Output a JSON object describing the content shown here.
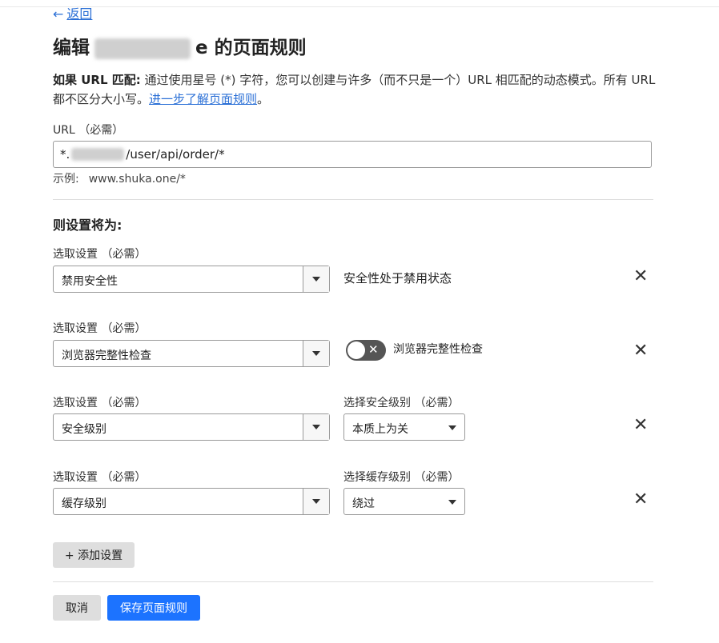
{
  "nav": {
    "back_arrow": "←",
    "back_label": "返回"
  },
  "page": {
    "title_prefix": "编辑",
    "title_partial": "e",
    "title_suffix": "的页面规则"
  },
  "description": {
    "bold": "如果 URL 匹配:",
    "text": " 通过使用星号 (*) 字符，您可以创建与许多（而不只是一个）URL 相匹配的动态模式。所有 URL 都不区分大小写。",
    "link": "进一步了解页面规则",
    "end": "。"
  },
  "url_field": {
    "label": "URL （必需）",
    "value_prefix": "*.",
    "value_suffix": "/user/api/order/*",
    "example_label": "示例:",
    "example_value": "www.shuka.one/*"
  },
  "settings_title": "则设置将为:",
  "settings": [
    {
      "label": "选取设置 （必需）",
      "value": "禁用安全性",
      "static_text": "安全性处于禁用状态"
    },
    {
      "label": "选取设置 （必需）",
      "value": "浏览器完整性检查",
      "toggle_label": "浏览器完整性检查",
      "toggle_on": false,
      "toggle_x": "✕"
    },
    {
      "label": "选取设置 （必需）",
      "value": "安全级别",
      "sub_label": "选择安全级别 （必需）",
      "sub_value": "本质上为关"
    },
    {
      "label": "选取设置 （必需）",
      "value": "缓存级别",
      "sub_label": "选择缓存级别 （必需）",
      "sub_value": "绕过"
    }
  ],
  "icons": {
    "close": "✕",
    "dropdown": "chevron-down-icon"
  },
  "buttons": {
    "add": "+ 添加设置",
    "cancel": "取消",
    "save": "保存页面规则"
  },
  "colors": {
    "primary": "#1c73ff",
    "link": "#2a6fd6",
    "toggle_off": "#555555"
  }
}
